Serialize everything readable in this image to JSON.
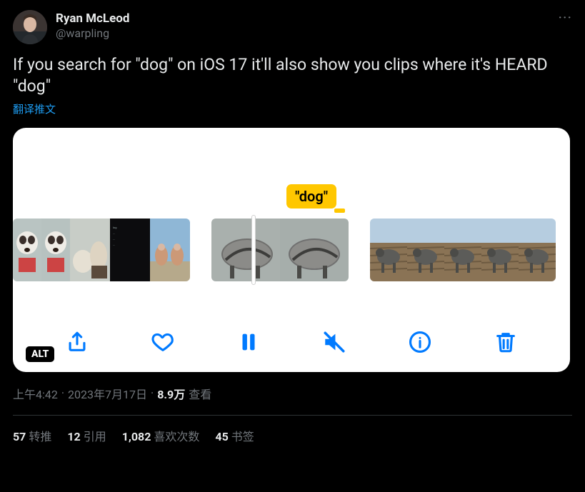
{
  "author": {
    "display_name": "Ryan McLeod",
    "handle": "@warpling"
  },
  "more_label": "···",
  "body": "If you search for \"dog\" on iOS 17 it'll also show you clips where it's HEARD \"dog\"",
  "translate_label": "翻译推文",
  "media": {
    "tooltip": "\"dog\"",
    "alt_badge": "ALT",
    "toolbar": {
      "share": "share",
      "like": "like",
      "pause": "pause",
      "mute": "mute",
      "info": "info",
      "delete": "delete"
    }
  },
  "meta": {
    "time": "上午4:42",
    "dot1": "·",
    "date": "2023年7月17日",
    "dot2": "·",
    "views_count": "8.9万",
    "views_label": "查看"
  },
  "stats": {
    "retweets_n": "57",
    "retweets_l": "转推",
    "quotes_n": "12",
    "quotes_l": "引用",
    "likes_n": "1,082",
    "likes_l": "喜欢次数",
    "bookmarks_n": "45",
    "bookmarks_l": "书签"
  }
}
